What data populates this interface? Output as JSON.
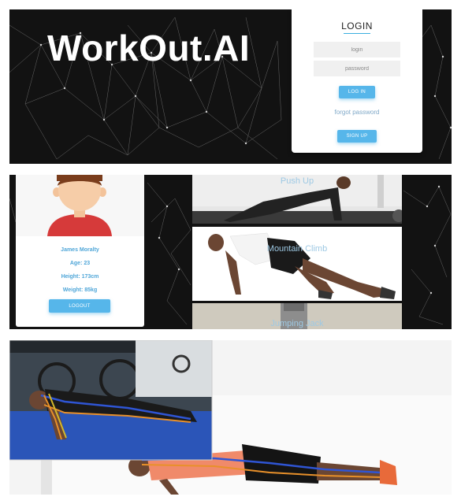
{
  "hero": {
    "brand": "WorkOut.AI",
    "login": {
      "title": "LOGIN",
      "login_placeholder": "login",
      "password_placeholder": "password",
      "login_button": "LOG IN",
      "forgot_password": "forgot password",
      "signup_button": "SIGN UP"
    }
  },
  "profile": {
    "name": "James Moralty",
    "age": "Age: 23",
    "height": "Height: 173cm",
    "weight": "Weight: 85kg",
    "logout_button": "LOGOUT"
  },
  "exercises": [
    {
      "title": "Push Up"
    },
    {
      "title": "Mountain Climb"
    },
    {
      "title": "Jumping Jack"
    }
  ],
  "colors": {
    "accent": "#56b6ea",
    "dark_bg": "#121212",
    "skeleton_blue": "#2f55d4",
    "skeleton_orange": "#e8902a"
  },
  "icons": [
    "network-background",
    "avatar-illustration",
    "pose-skeleton"
  ]
}
